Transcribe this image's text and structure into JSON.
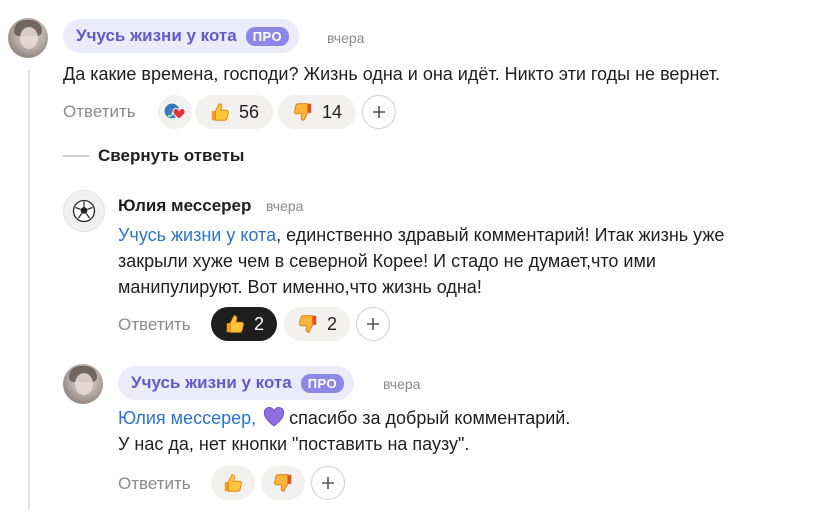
{
  "comments": [
    {
      "author": "Учусь жизни у кота",
      "badge": "ПРО",
      "time": "вчера",
      "text": "Да какие времена, господи? Жизнь одна и она идёт. Никто эти годы не вернет.",
      "reply_label": "Ответить",
      "likes": "56",
      "dislikes": "14"
    }
  ],
  "collapse_label": "Свернуть ответы",
  "replies": [
    {
      "author": "Юлия мессерер",
      "time": "вчера",
      "mention": "Учусь жизни у кота",
      "text_line1_rest": ", единственно здравый комментарий! Итак жизнь уже",
      "text_line2": "закрыли хуже чем в северной Корее! И стадо не думает,что ими",
      "text_line3": "манипулируют. Вот именно,что жизнь одна!",
      "reply_label": "Ответить",
      "likes": "2",
      "dislikes": "2"
    },
    {
      "author": "Учусь жизни у кота",
      "badge": "ПРО",
      "time": "вчера",
      "mention": "Юлия мессерер,",
      "text_line1_rest": "спасибо за добрый комментарий.",
      "text_line2": "У нас да, нет кнопки \"поставить на паузу\".",
      "reply_label": "Ответить",
      "heart_icon": "purple-heart-icon"
    }
  ],
  "colors": {
    "accent": "#6558c9",
    "pill_bg": "#ecebfa",
    "badge": "#8f87e6",
    "link": "#2b74c9",
    "reaction_bg": "#f2f1f0",
    "active_reaction_bg": "#1e1e1e"
  }
}
